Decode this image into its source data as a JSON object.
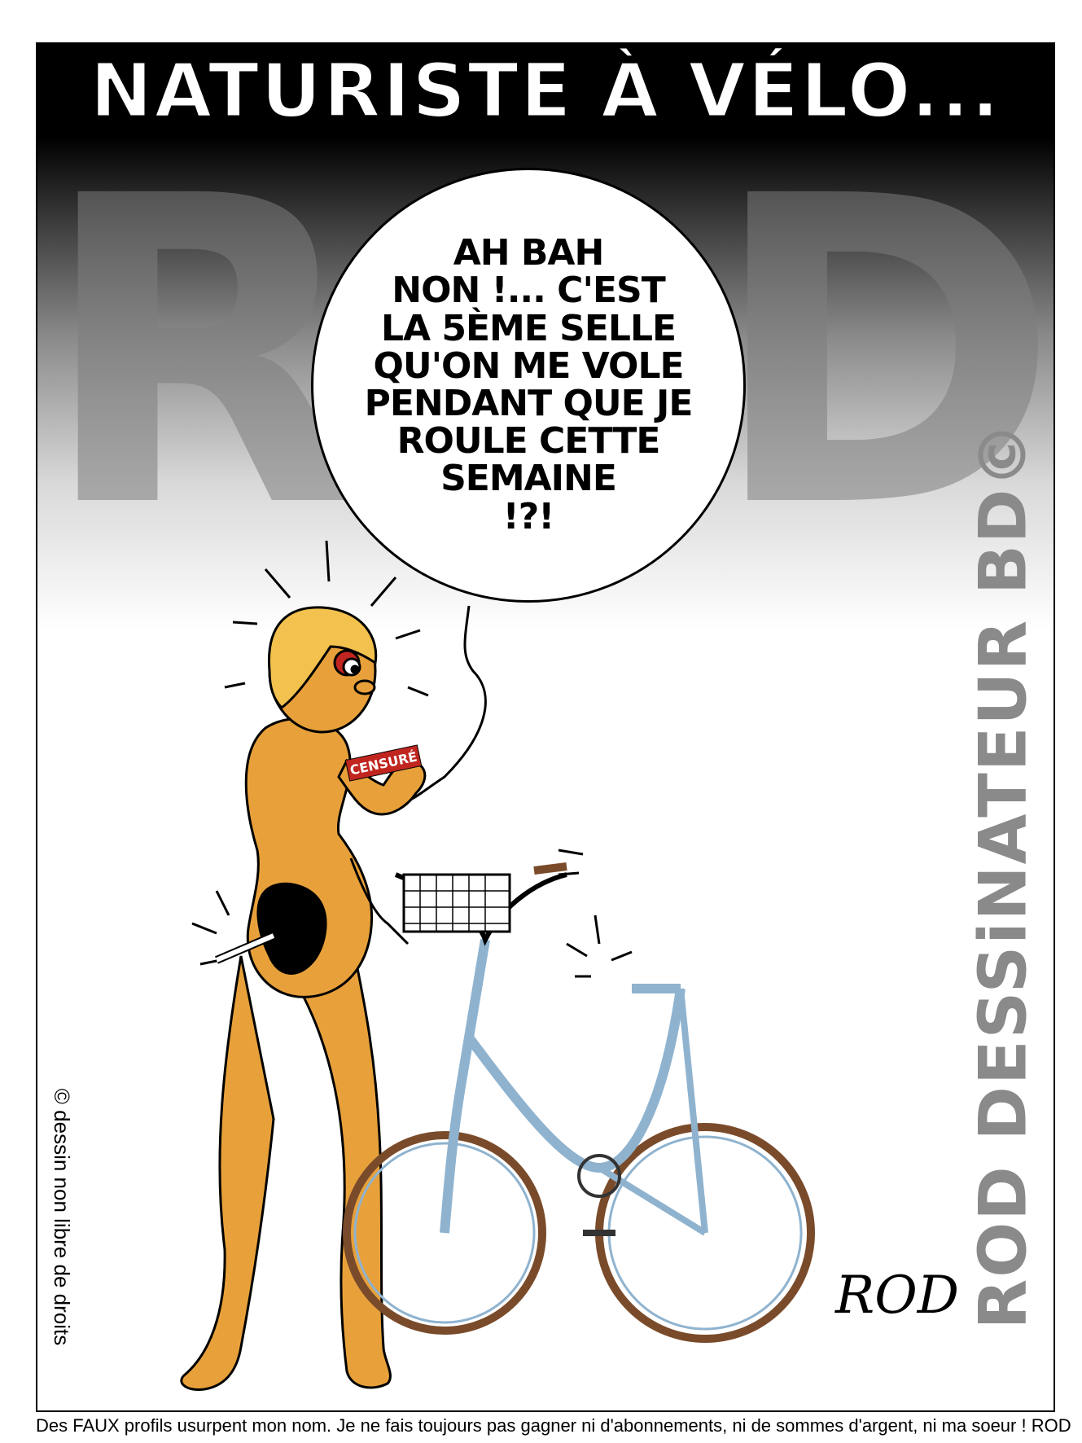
{
  "title": "NATURISTE À VÉLO...",
  "watermark": "ROD",
  "balloon": {
    "lines": [
      "AH BAH",
      "NON !... C'EST",
      "LA 5ÈME SELLE",
      "QU'ON ME VOLE",
      "PENDANT QUE JE",
      "ROULE CETTE",
      "SEMAINE",
      "!?!"
    ]
  },
  "censor_label": "CENSURÉ",
  "side_credit": "ROD DESSiNATEUR BD©",
  "left_note": "© dessin non libre de droits",
  "signature": "ROD",
  "footer": "Des FAUX profils usurpent mon nom. Je ne fais toujours pas gagner ni d'abonnements, ni de sommes d'argent, ni ma soeur ! ROD",
  "colors": {
    "skin": "#e8a13a",
    "bike_frame": "#8fb3cf",
    "tire": "#7a4b2a",
    "censor": "#c0261f"
  }
}
